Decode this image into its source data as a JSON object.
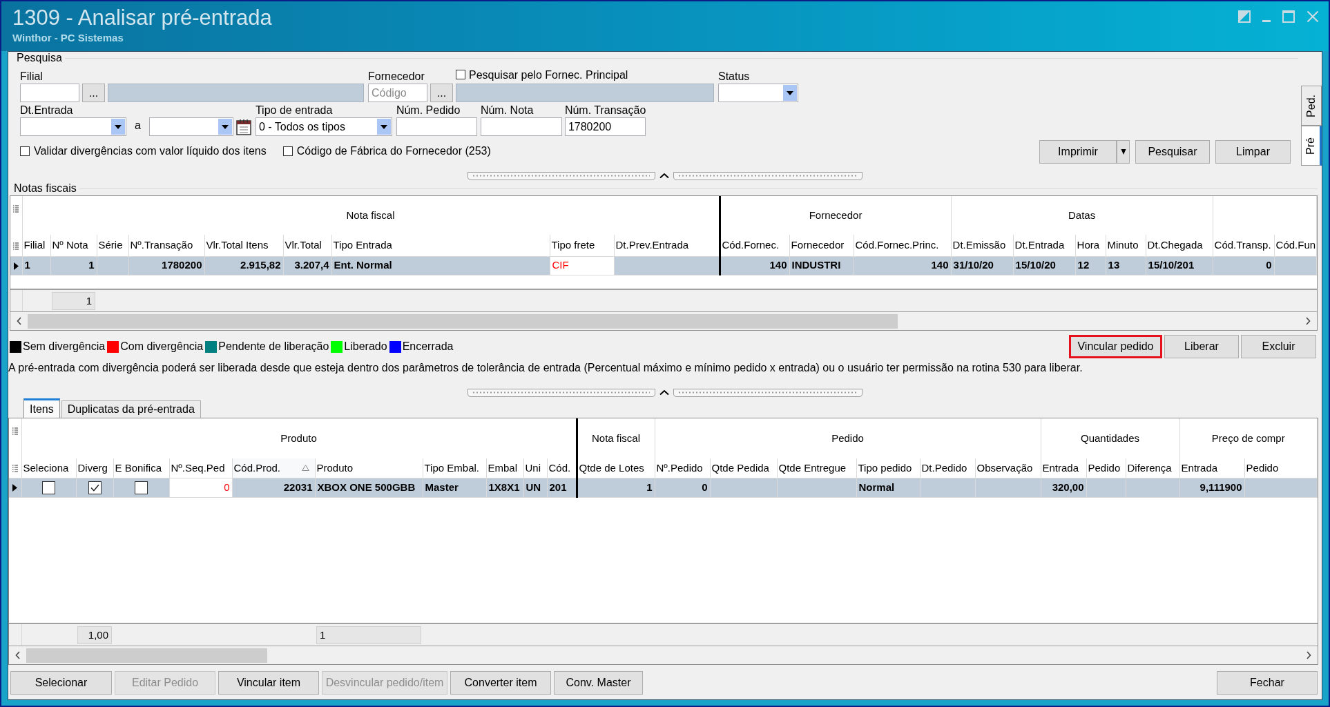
{
  "window": {
    "title": "1309 - Analisar pré-entrada",
    "subtitle": "Winthor - PC Sistemas"
  },
  "search": {
    "title": "Pesquisa",
    "filial": {
      "label": "Filial",
      "button": "..."
    },
    "fornecedor": {
      "label": "Fornecedor",
      "placeholder": "Código",
      "button": "..."
    },
    "principal_checkbox": {
      "label": "Pesquisar pelo Fornec. Principal",
      "checked": false
    },
    "status": {
      "label": "Status"
    },
    "dt_entrada": {
      "label": "Dt.Entrada",
      "separator": "a"
    },
    "tipo_entrada": {
      "label": "Tipo de entrada",
      "value": "0 - Todos os tipos"
    },
    "num_pedido": {
      "label": "Núm. Pedido"
    },
    "num_nota": {
      "label": "Núm. Nota"
    },
    "num_transacao": {
      "label": "Núm. Transação",
      "value": "1780200"
    },
    "checkboxes": [
      {
        "label": "Validar divergências com valor líquido dos itens",
        "checked": false
      },
      {
        "label": "Código de Fábrica do Fornecedor (253)",
        "checked": false
      }
    ],
    "buttons": [
      {
        "label": "Imprimir",
        "kind": "split"
      },
      {
        "label": "Pesquisar",
        "kind": "plain"
      },
      {
        "label": "Limpar",
        "kind": "plain"
      }
    ]
  },
  "side_tabs": [
    {
      "label": "Ped.",
      "selected": false
    },
    {
      "label": "Pré",
      "selected": true
    }
  ],
  "notas": {
    "title": "Notas fiscais",
    "groups": [
      {
        "label": "Nota fiscal",
        "columns": [
          {
            "label": "Filial"
          },
          {
            "label": "Nº Nota",
            "total": "1"
          },
          {
            "label": "Série"
          },
          {
            "label": "Nº.Transação"
          },
          {
            "label": "Vlr.Total Itens"
          },
          {
            "label": "Vlr.Total"
          },
          {
            "label": "Tipo Entrada"
          },
          {
            "label": "Tipo frete"
          },
          {
            "label": "Dt.Prev.Entrada"
          }
        ]
      },
      {
        "label": "Fornecedor",
        "columns": [
          {
            "label": "Cód.Fornec."
          },
          {
            "label": "Fornecedor"
          },
          {
            "label": "Cód.Fornec.Princ."
          }
        ]
      },
      {
        "label": "Datas",
        "columns": [
          {
            "label": "Dt.Emissão"
          },
          {
            "label": "Dt.Entrada"
          },
          {
            "label": "Hora"
          },
          {
            "label": "Minuto"
          },
          {
            "label": "Dt.Chegada"
          }
        ]
      },
      {
        "columns": [
          {
            "label": "Cód.Transp."
          },
          {
            "label": "Cód.Fun"
          }
        ]
      }
    ],
    "rows": [
      {
        "selected": true,
        "cells": [
          "1",
          "1",
          null,
          "1780200",
          "2.915,82",
          "3.207,4",
          "Ent. Normal",
          {
            "text": "CIF",
            "kind": "editable"
          },
          null,
          "140",
          "INDUSTRI",
          "140",
          "31/10/20",
          "15/10/20",
          "12",
          "13",
          "15/10/201",
          "0",
          null
        ]
      }
    ]
  },
  "legend": [
    {
      "label": "Sem divergência",
      "color": "#000000"
    },
    {
      "label": "Com divergência",
      "color": "#ff0000"
    },
    {
      "label": "Pendente de liberação",
      "color": "#008080"
    },
    {
      "label": "Liberado",
      "color": "#00ff00"
    },
    {
      "label": "Encerrada",
      "color": "#0000ff"
    }
  ],
  "actions": [
    {
      "label": "Vincular pedido",
      "highlighted": true
    },
    {
      "label": "Liberar",
      "highlighted": false
    },
    {
      "label": "Excluir",
      "highlighted": false
    }
  ],
  "message": "A pré-entrada com divergência poderá ser liberada desde que esteja dentro dos parâmetros de tolerância de entrada (Percentual máximo e mínimo pedido x entrada) ou o usuário ter permissão na rotina 530 para liberar.",
  "tabs": [
    {
      "label": "Itens",
      "selected": true
    },
    {
      "label": "Duplicatas da pré-entrada",
      "selected": false
    }
  ],
  "itens": {
    "groups": [
      {
        "label": "Produto",
        "columns": [
          {
            "label": "Seleciona",
            "sorted": false
          },
          {
            "label": "Diverg",
            "total": "1,00",
            "sorted": false
          },
          {
            "label": "E Bonifica",
            "sorted": false
          },
          {
            "label": "Nº.Seq.Ped",
            "sorted": false
          },
          {
            "label": "Cód.Prod.",
            "sorted": true
          },
          {
            "label": "Produto",
            "total": "1",
            "sorted": false
          },
          {
            "label": "Tipo Embal.",
            "sorted": false
          },
          {
            "label": "Embal",
            "sorted": false
          },
          {
            "label": "Uni",
            "sorted": false
          },
          {
            "label": "Cód.",
            "sorted": false
          }
        ]
      },
      {
        "label": "Nota fiscal",
        "columns": [
          {
            "label": "Qtde de Lotes",
            "sorted": false
          }
        ]
      },
      {
        "label": "Pedido",
        "columns": [
          {
            "label": "Nº.Pedido",
            "sorted": false
          },
          {
            "label": "Qtde Pedida",
            "sorted": false
          },
          {
            "label": "Qtde Entregue",
            "sorted": false
          },
          {
            "label": "Tipo pedido",
            "sorted": false
          },
          {
            "label": "Dt.Pedido",
            "sorted": false
          },
          {
            "label": "Observação",
            "sorted": false
          }
        ]
      },
      {
        "label": "Quantidades",
        "columns": [
          {
            "label": "Entrada",
            "sorted": false
          },
          {
            "label": "Pedido",
            "sorted": false
          },
          {
            "label": "Diferença",
            "sorted": false
          }
        ]
      },
      {
        "label": "Preço de compr",
        "columns": [
          {
            "label": "Entrada",
            "sorted": false
          },
          {
            "label": "Pedido",
            "sorted": false
          }
        ]
      }
    ],
    "rows": [
      {
        "selected": true,
        "cells": [
          {
            "kind": "checkbox",
            "checked": false
          },
          {
            "kind": "checkbox",
            "checked": true
          },
          {
            "kind": "checkbox",
            "checked": false
          },
          {
            "text": "0",
            "kind": "editable"
          },
          "22031",
          "XBOX ONE 500GBB",
          "Master",
          "1X8X1",
          "UN",
          "201",
          "1",
          "0",
          null,
          null,
          "Normal",
          null,
          null,
          "320,00",
          null,
          null,
          "9,111900",
          null
        ]
      }
    ]
  },
  "bottom_buttons": [
    {
      "label": "Selecionar",
      "disabled": false
    },
    {
      "label": "Editar Pedido",
      "disabled": true
    },
    {
      "label": "Vincular item",
      "disabled": false
    },
    {
      "label": "Desvincular pedido/item",
      "disabled": true
    },
    {
      "label": "Converter item",
      "disabled": false
    },
    {
      "label": "Conv. Master",
      "disabled": false
    }
  ],
  "close_button": {
    "label": "Fechar"
  }
}
